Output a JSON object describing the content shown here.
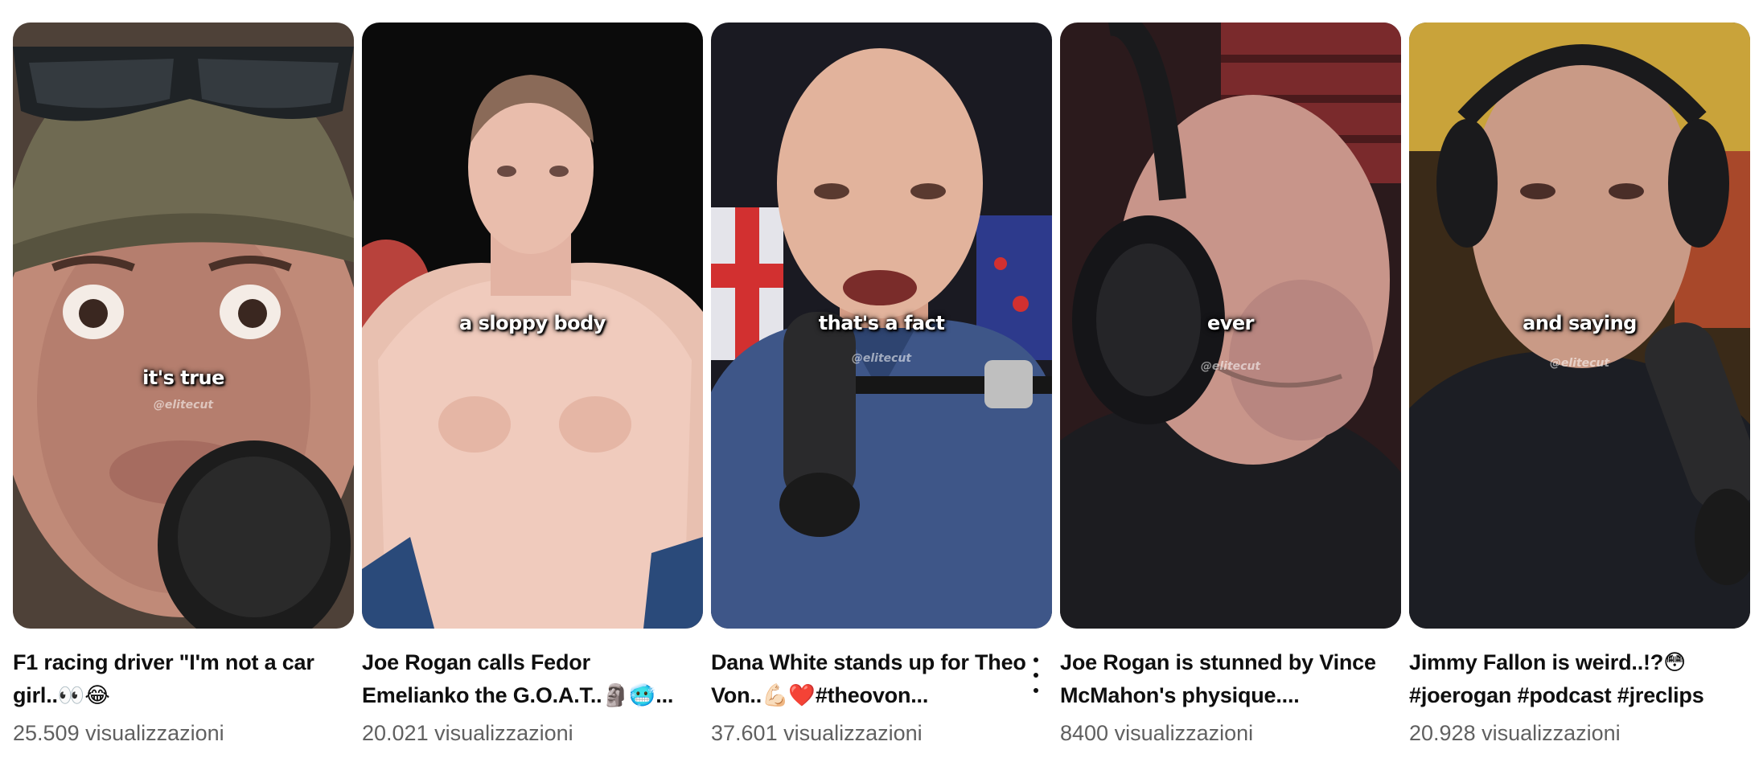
{
  "shorts": [
    {
      "title": "F1 racing driver \"I'm not a car girl..👀😂",
      "views": "25.509 visualizzazioni",
      "caption": "it's true",
      "watermark": "@elitecut"
    },
    {
      "title": "Joe Rogan calls Fedor Emelianko the G.O.A.T..🗿🥶...",
      "views": "20.021 visualizzazioni",
      "caption": "a sloppy body",
      "watermark": ""
    },
    {
      "title": "Dana White stands up for Theo Von..💪🏻❤️#theovon...",
      "views": "37.601 visualizzazioni",
      "caption": "that's a fact",
      "watermark": "@elitecut"
    },
    {
      "title": "Joe Rogan is stunned by Vince McMahon's physique....",
      "views": "8400 visualizzazioni",
      "caption": "ever",
      "watermark": "@elitecut"
    },
    {
      "title": "Jimmy Fallon is weird..!?😳 #joerogan #podcast #jreclips",
      "views": "20.928 visualizzazioni",
      "caption": "and saying",
      "watermark": "@elitecut"
    }
  ],
  "icons": {
    "more_actions": "vertical-dots-icon"
  }
}
